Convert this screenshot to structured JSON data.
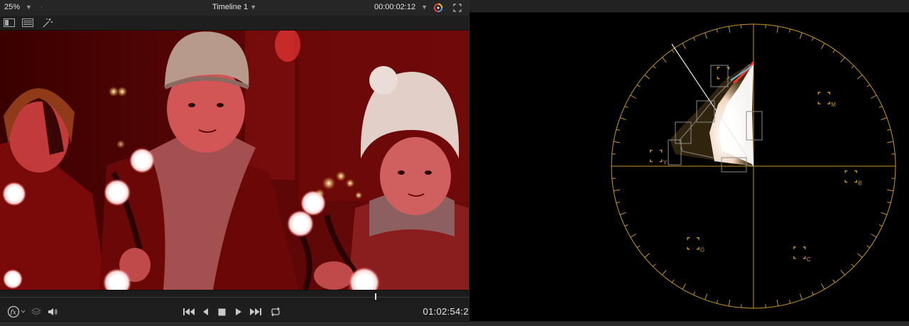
{
  "viewer": {
    "zoom_value": "25%",
    "timeline_name": "Timeline 1",
    "timecode_top": "00:00:02:12",
    "timecode_bottom": "01:02:54:2",
    "playhead_fraction": 0.8
  },
  "toolbar_icons": [
    "viewer-layout-icon",
    "clip-list-icon",
    "magic-wand-icon"
  ],
  "transport_icons": [
    "fx-icon",
    "layers-icon",
    "speaker-icon",
    "skip-to-start-icon",
    "step-back-icon",
    "stop-icon",
    "play-icon",
    "skip-to-end-icon",
    "loop-icon"
  ],
  "vectorscope": {
    "targets": [
      {
        "label": "M"
      },
      {
        "label": "B"
      },
      {
        "label": "C"
      },
      {
        "label": "G"
      },
      {
        "label": "Y"
      },
      {
        "label": "R"
      }
    ],
    "graticule_color": "#c8962a",
    "trace_color": "#ffffff"
  },
  "colors": {
    "accent": "#c8962a",
    "panel": "#1e1e1e",
    "scope_bg": "#000000"
  }
}
